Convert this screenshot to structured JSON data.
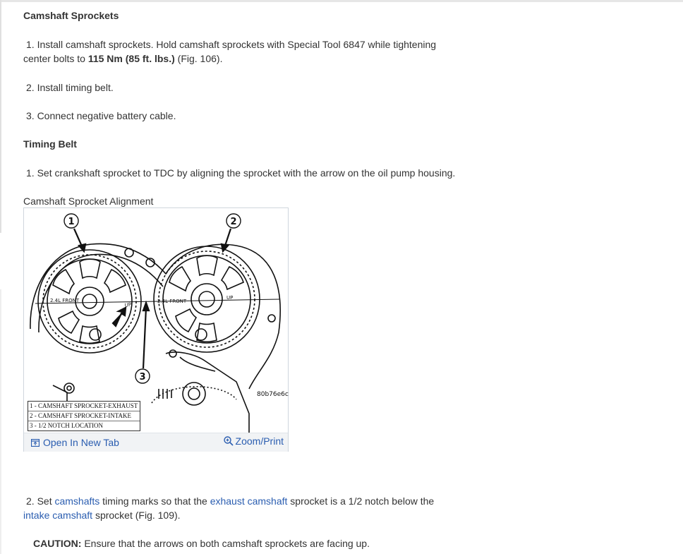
{
  "section1": {
    "heading": "Camshaft Sprockets",
    "step1_text_a": "1. Install camshaft sprockets. Hold camshaft sprockets with Special Tool 6847 while tightening",
    "step1_text_b": "center bolts to ",
    "step1_bold": "115 Nm (85 ft. lbs.)",
    "step1_text_c": " (Fig. 106).",
    "step2": "2. Install timing belt.",
    "step3": "3. Connect negative battery cable."
  },
  "section2": {
    "heading": "Timing Belt",
    "step1": "1. Set crankshaft sprocket to TDC by aligning the sprocket with the arrow on the oil pump housing.",
    "figure_caption": "Camshaft Sprocket Alignment",
    "figure": {
      "callouts": [
        "1",
        "2",
        "3"
      ],
      "sprocket_labels": [
        "2.4L FRONT",
        "UP",
        "2.4L FRONT",
        "UP"
      ],
      "code": "80b76e6c",
      "legend": [
        "1 - CAMSHAFT SPROCKET-EXHAUST",
        "2 - CAMSHAFT SPROCKET-INTAKE",
        "3 - 1/2 NOTCH LOCATION"
      ],
      "open_label": "Open In New Tab",
      "zoom_label": "Zoom/Print"
    },
    "step2_a": "2. Set ",
    "step2_link1": "camshafts",
    "step2_b": " timing marks so that the ",
    "step2_link2": "exhaust camshaft",
    "step2_c": " sprocket is a 1/2 notch below the",
    "step2_link3": "intake camshaft",
    "step2_d": " sprocket (Fig. 109).",
    "caution_label": "CAUTION:",
    "caution_text": " Ensure that the arrows on both camshaft sprockets are facing up."
  },
  "colors": {
    "link": "#2a5db0",
    "text": "#333333"
  },
  "icons": {
    "open": "open-new-tab-icon",
    "zoom": "zoom-icon"
  }
}
